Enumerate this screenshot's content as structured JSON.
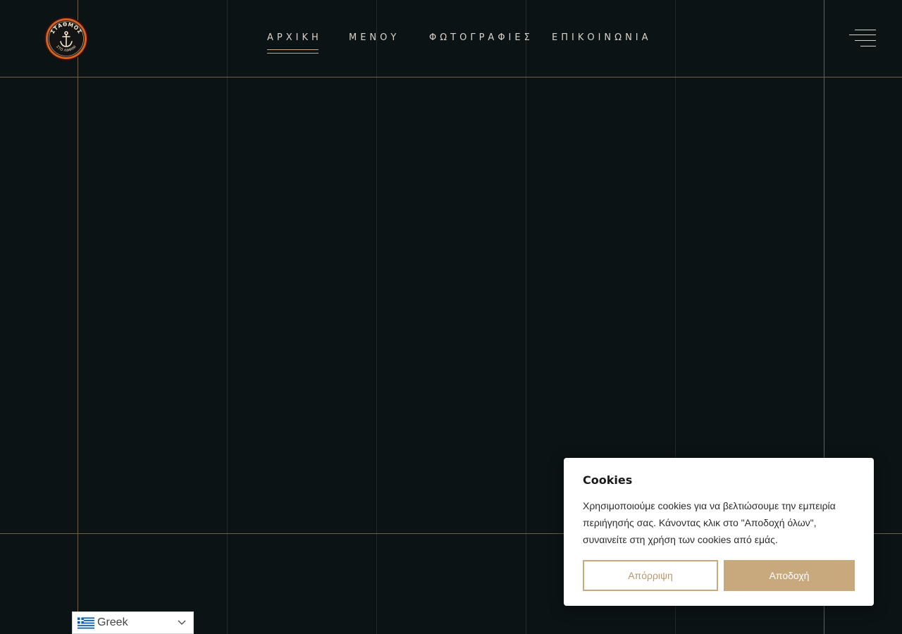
{
  "header": {
    "logo": {
      "top_text": "ΣΤΑΘΜΟΣ",
      "bottom_text": "ΣΤΟ ΛΙΜΑΝΙ",
      "icon": "anchor-icon"
    },
    "nav": [
      {
        "label": "ΑΡΧΙΚΗ",
        "active": true
      },
      {
        "label": "ΜΕΝΟΥ",
        "active": false
      },
      {
        "label": "ΦΩΤΟΓΡΑΦΙΕΣ",
        "active": false
      },
      {
        "label": "ΕΠΙΚΟΙΝΩΝΙΑ",
        "active": false
      }
    ],
    "menu_icon": "hamburger-menu-icon"
  },
  "cookie": {
    "title": "Cookies",
    "text": "Χρησιμοποιούμε cookies για να βελτιώσουμε την εμπειρία περιήγησής σας. Κάνοντας κλικ στο \"Αποδοχή όλων\", συναινείτε στη χρήση των cookies από εμάς.",
    "reject_label": "Απόρριψη",
    "accept_label": "Αποδοχή"
  },
  "language": {
    "selected": "Greek",
    "flag_icon": "greece-flag-icon",
    "chevron_icon": "chevron-down-icon"
  },
  "colors": {
    "background": "#0c1315",
    "accent_gold": "#c8a97e",
    "nav_text": "#d8d2c8"
  }
}
